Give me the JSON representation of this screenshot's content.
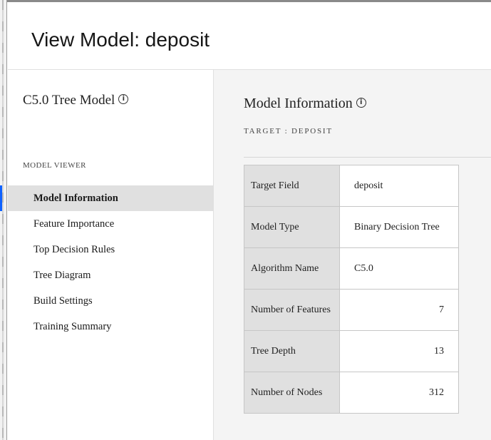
{
  "header": {
    "title": "View Model: deposit"
  },
  "sidebar": {
    "model_title": "C5.0 Tree Model",
    "section_label": "MODEL VIEWER",
    "items": [
      {
        "label": "Model Information",
        "active": true
      },
      {
        "label": "Feature Importance",
        "active": false
      },
      {
        "label": "Top Decision Rules",
        "active": false
      },
      {
        "label": "Tree Diagram",
        "active": false
      },
      {
        "label": "Build Settings",
        "active": false
      },
      {
        "label": "Training Summary",
        "active": false
      }
    ]
  },
  "main": {
    "title": "Model Information",
    "target_label": "TARGET : DEPOSIT",
    "rows": [
      {
        "label": "Target Field",
        "value": "deposit"
      },
      {
        "label": "Model Type",
        "value": "Binary Decision Tree"
      },
      {
        "label": "Algorithm Name",
        "value": "C5.0"
      },
      {
        "label": "Number of Features",
        "value": "7"
      },
      {
        "label": "Tree Depth",
        "value": "13"
      },
      {
        "label": "Number of Nodes",
        "value": "312"
      }
    ]
  },
  "icons": {
    "info": "info-icon"
  },
  "colors": {
    "active_indicator": "#0f62fe",
    "main_background": "#f4f4f4",
    "label_cell": "#e0e0e0"
  }
}
